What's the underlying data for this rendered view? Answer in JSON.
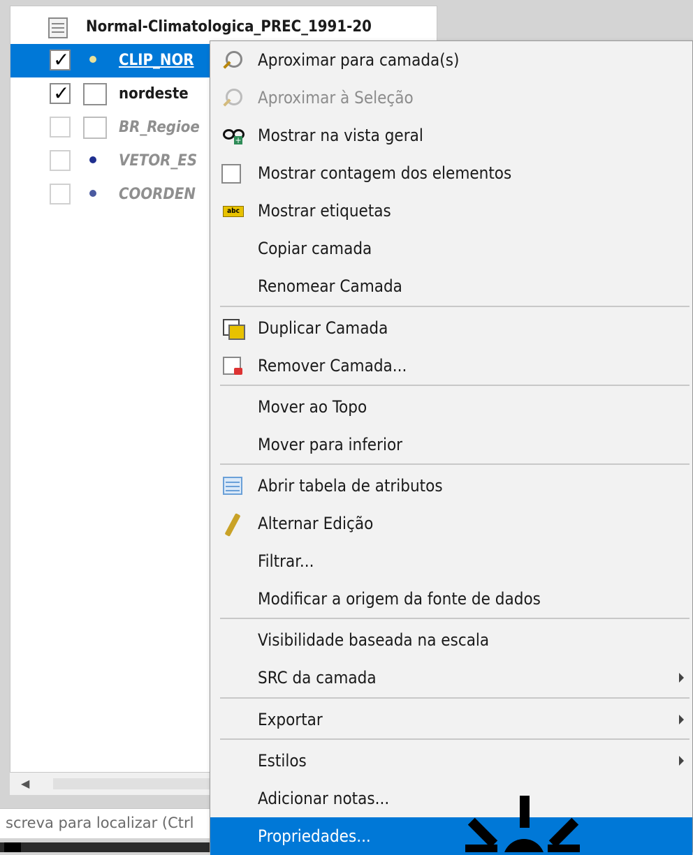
{
  "layers": {
    "group_name": "Normal-Climatologica_PREC_1991-20",
    "items": [
      {
        "name": "CLIP_NOR",
        "checked": true,
        "symbol": "dot",
        "dot_color": "#e9e19a",
        "state": "selected"
      },
      {
        "name": "nordeste",
        "checked": true,
        "symbol": "square",
        "state": "active"
      },
      {
        "name": "BR_Regioe",
        "checked": false,
        "symbol": "square",
        "state": "inactive"
      },
      {
        "name": "VETOR_ES",
        "checked": false,
        "symbol": "dot",
        "dot_color": "#1f2f8f",
        "state": "inactive"
      },
      {
        "name": "COORDEN",
        "checked": false,
        "symbol": "dot",
        "dot_color": "#4a5aa0",
        "state": "inactive"
      }
    ]
  },
  "search": {
    "placeholder": "screva para localizar (Ctrl"
  },
  "context_menu": {
    "items": [
      {
        "label": "Aproximar para camada(s)",
        "icon": "zoom-layer-icon"
      },
      {
        "label": "Aproximar à Seleção",
        "icon": "zoom-selection-icon",
        "disabled": true
      },
      {
        "label": "Mostrar na vista geral",
        "icon": "overview-icon"
      },
      {
        "label": "Mostrar contagem dos elementos",
        "icon": "checkbox-icon"
      },
      {
        "label": "Mostrar etiquetas",
        "icon": "labels-icon"
      },
      {
        "label": "Copiar camada"
      },
      {
        "label": "Renomear Camada"
      },
      {
        "label": "Duplicar Camada",
        "icon": "duplicate-layer-icon"
      },
      {
        "label": "Remover Camada...",
        "icon": "remove-layer-icon"
      },
      {
        "label": "Mover ao Topo"
      },
      {
        "label": "Mover para inferior"
      },
      {
        "label": "Abrir tabela de atributos",
        "icon": "attribute-table-icon"
      },
      {
        "label": "Alternar Edição",
        "icon": "pencil-icon"
      },
      {
        "label": "Filtrar..."
      },
      {
        "label": "Modificar a origem da fonte de dados"
      },
      {
        "label": "Visibilidade baseada na escala"
      },
      {
        "label": "SRC da camada",
        "submenu": true
      },
      {
        "label": "Exportar",
        "submenu": true
      },
      {
        "label": "Estilos",
        "submenu": true
      },
      {
        "label": "Adicionar notas..."
      },
      {
        "label": "Propriedades...",
        "highlighted": true
      }
    ]
  },
  "colors": {
    "selection": "#0078d7",
    "menu_bg": "#f2f2f2"
  }
}
